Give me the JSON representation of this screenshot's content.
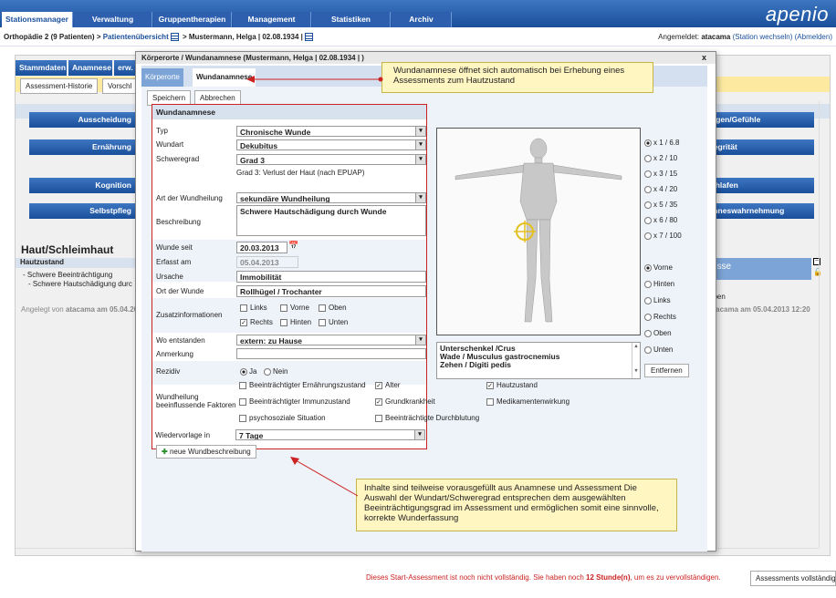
{
  "topnav": {
    "tabs": [
      "Stationsmanager",
      "Verwaltung",
      "Gruppentherapien",
      "Management",
      "Statistiken",
      "Archiv"
    ],
    "logo": "apenio"
  },
  "crumb": {
    "station": "Orthopädie 2 (9 Patienten)",
    "sep": ">",
    "overview": "Patientenübersicht",
    "patient": "Mustermann, Helga | 02.08.1934 |",
    "login_label": "Angemeldet:",
    "user": "atacama",
    "switch": "(Station wechseln)",
    "logout": "(Abmelden)"
  },
  "background": {
    "tabs": [
      "Stammdaten",
      "Anamnese",
      "erw."
    ],
    "btn1": "Assessment-Historie",
    "btn2": "Vorschl",
    "rows_left": [
      "Ausscheidung",
      "Ernährung",
      "Kognition",
      "Selbstpfleg"
    ],
    "rows_right": [
      "ngen/Gefühle",
      "tegrität",
      "chlafen",
      "inneswahrnehmung"
    ],
    "section_title": "Haut/Schleimhaut",
    "sub": "Hautzustand",
    "items": [
      "- Schwere Beeinträchtigung",
      "- Schwere Hautschädigung durc"
    ],
    "created": "Angelegt von",
    "created_user": "atacama am 05.04.20",
    "right_haben": "aben",
    "right_created": "atacama am 05.04.2013 12:20",
    "right_hdr": "usse"
  },
  "modal": {
    "title": "Körperorte / Wundanamnese (Mustermann, Helga | 02.08.1934 | )",
    "close": "x",
    "tab1": "Körperorte",
    "tab2": "Wundanamnese",
    "save": "Speichern",
    "cancel": "Abbrechen",
    "section": "Wundanamnese",
    "new_btn": "neue Wundbeschreibung"
  },
  "form": {
    "typ_l": "Typ",
    "typ_v": "Chronische Wunde",
    "art_l": "Wundart",
    "art_v": "Dekubitus",
    "grad_l": "Schweregrad",
    "grad_v": "Grad 3",
    "grad_note": "Grad 3: Verlust der Haut (nach EPUAP)",
    "heil_l": "Art der Wundheilung",
    "heil_v": "sekundäre Wundheilung",
    "desc_l": "Beschreibung",
    "desc_v": "Schwere Hautschädigung durch Wunde",
    "seit_l": "Wunde seit",
    "seit_v": "20.03.2013",
    "erf_l": "Erfasst am",
    "erf_v": "05.04.2013",
    "urs_l": "Ursache",
    "urs_v": "Immobilität",
    "ort_l": "Ort der Wunde",
    "ort_v": "Rollhügel / Trochanter",
    "zus_l": "Zusatzinformationen",
    "zus_opts": [
      "Links",
      "Vorne",
      "Oben",
      "Rechts",
      "Hinten",
      "Unten"
    ],
    "wo_l": "Wo entstanden",
    "wo_v": "extern: zu Hause",
    "anm_l": "Anmerkung",
    "rez_l": "Rezidiv",
    "rez_ja": "Ja",
    "rez_nein": "Nein",
    "fak_l1": "Wundheilung",
    "fak_l2": "beeinflussende Faktoren",
    "fak": [
      "Beeinträchtigter Ernährungszustand",
      "Alter",
      "Hautzustand",
      "Beeinträchtigter Immunzustand",
      "Grundkrankheit",
      "Medikamentenwirkung",
      "psychosoziale Situation",
      "Beeinträchtigte Durchblutung"
    ],
    "wv_l": "Wiedervorlage in",
    "wv_v": "7 Tage"
  },
  "zoom": [
    "x 1 / 6.8",
    "x 2 / 10",
    "x 3 / 15",
    "x 4 / 20",
    "x 5 / 35",
    "x 6 / 80",
    "x 7 / 100"
  ],
  "views": [
    "Vorne",
    "Hinten",
    "Links",
    "Rechts",
    "Oben",
    "Unten"
  ],
  "locations": [
    "Unterschenkel /Crus",
    "Wade / Musculus gastrocnemius",
    "Zehen / Digiti pedis"
  ],
  "remove": "Entfernen",
  "callout1": "Wundanamnese öffnet sich automatisch bei Erhebung eines Assessments zum Hautzustand",
  "callout2": "Inhalte sind teilweise vorausgefüllt aus Anamnese und Assessment Die Auswahl der Wundart/Schweregrad entsprechen dem ausgewählten Beeinträchtigungsgrad im Assessment und ermöglichen somit eine sinnvolle, korrekte Wunderfassung",
  "footer": {
    "msg1": "Dieses Start-Assessment ist noch nicht vollständig. Sie haben noch",
    "hours": "12 Stunde(n)",
    "msg2": ", um es zu vervollständigen.",
    "btn": "Assessments vollständig"
  },
  "colors": {
    "accent": "#1a4f9a",
    "callout": "#fff6c2",
    "error": "#cc2222"
  }
}
